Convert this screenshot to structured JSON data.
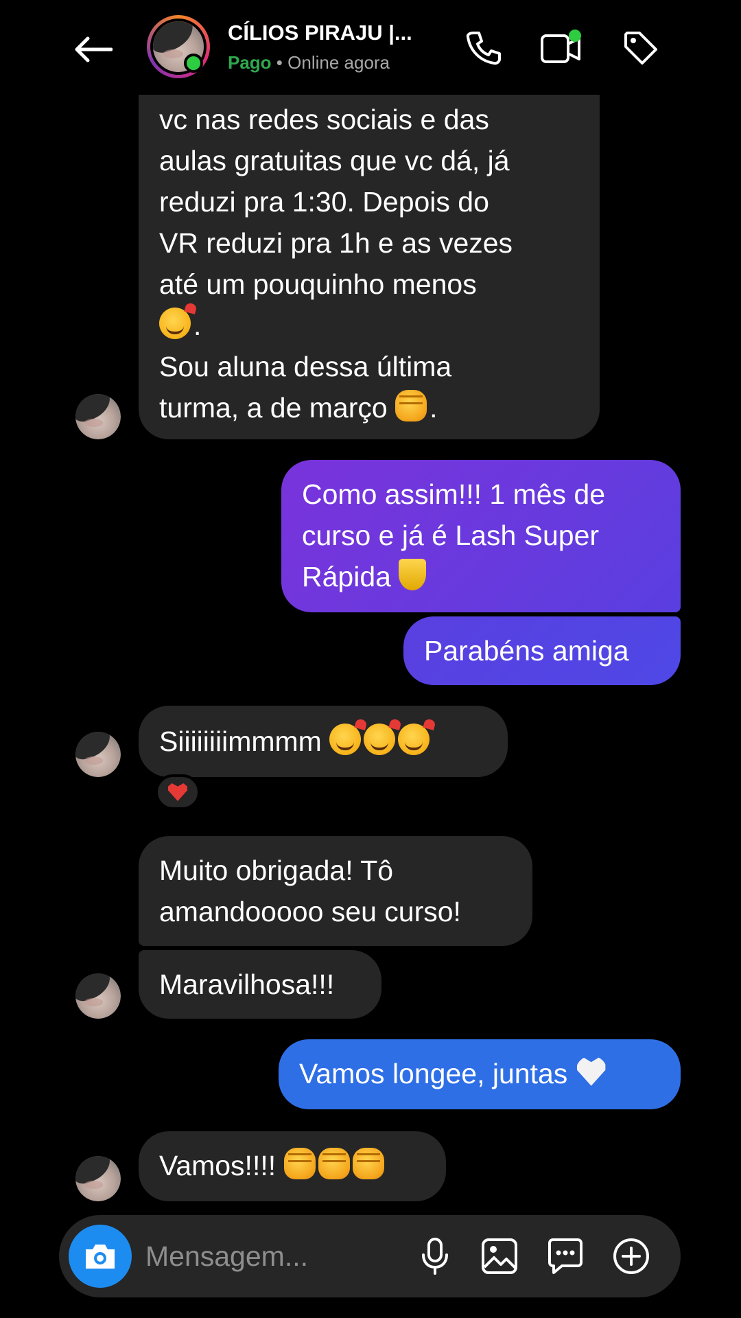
{
  "header": {
    "contact_name": "CÍLIOS PIRAJU |...",
    "status_paid": "Pago",
    "status_separator": " • ",
    "status_online": "Online agora"
  },
  "messages": [
    {
      "from": "them",
      "lines": [
        "vc nas redes sociais e das",
        "aulas gratuitas que vc dá, já",
        "reduzi pra 1:30. Depois do",
        "VR reduzi pra 1h e as vezes",
        "até um pouquinho menos"
      ],
      "line_after_emoji": ".",
      "line_last_a": "Sou aluna dessa última",
      "line_last_b": "turma, a de março",
      "line_last_suffix": "."
    },
    {
      "from": "me",
      "lines": [
        "Como assim!!! 1 mês de",
        "curso e já é Lash Super",
        "Rápida"
      ]
    },
    {
      "from": "me",
      "text": "Parabéns amiga"
    },
    {
      "from": "them",
      "text": "Siiiiiiiimmmm"
    },
    {
      "from": "them",
      "lines": [
        "Muito obrigada! Tô",
        "amandooooo seu curso!"
      ]
    },
    {
      "from": "them",
      "text": "Maravilhosa!!!"
    },
    {
      "from": "me",
      "text": "Vamos longee, juntas"
    },
    {
      "from": "them",
      "text": "Vamos!!!!"
    }
  ],
  "reaction": {
    "emoji_name": "red-heart-icon"
  },
  "composer": {
    "placeholder": "Mensagem..."
  },
  "colors": {
    "accent_blue": "#2f6fe6",
    "accent_purple": "#7a33db",
    "incoming_bubble": "#262626",
    "paid_green": "#2fa84f",
    "camera_button": "#1d8cf0"
  }
}
